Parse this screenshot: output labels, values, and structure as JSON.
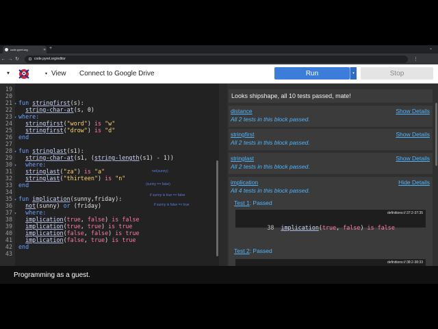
{
  "browser": {
    "tab_title": "code.pyret.org",
    "new_tab": "+",
    "url": "code.pyret.org/editor",
    "back": "←",
    "forward": "→",
    "reload": "↻",
    "menu": "⋮"
  },
  "toolbar": {
    "menu_icon": "▾",
    "view_caret": "▾",
    "view_label": "View",
    "drive_label": "Connect to Google Drive",
    "run_label": "Run",
    "run_dropdown": "▾",
    "stop_label": "Stop"
  },
  "editor": {
    "lines": [
      {
        "n": "19",
        "fold": "",
        "tokens": []
      },
      {
        "n": "20",
        "fold": "",
        "tokens": []
      },
      {
        "n": "21",
        "fold": "▾",
        "tokens": [
          [
            "kw",
            "fun "
          ],
          [
            "fn",
            "stringfirst"
          ],
          [
            "txt",
            "(s):"
          ]
        ]
      },
      {
        "n": "22",
        "fold": "",
        "tokens": [
          [
            "txt",
            "  "
          ],
          [
            "fn",
            "string-char-at"
          ],
          [
            "txt",
            "(s, "
          ],
          [
            "num",
            "0"
          ],
          [
            "txt",
            ")"
          ]
        ]
      },
      {
        "n": "23",
        "fold": "▾",
        "tokens": [
          [
            "kw",
            "where:"
          ]
        ]
      },
      {
        "n": "24",
        "fold": "",
        "tokens": [
          [
            "txt",
            "  "
          ],
          [
            "fn",
            "stringfirst"
          ],
          [
            "txt",
            "("
          ],
          [
            "str",
            "\"word\""
          ],
          [
            "txt",
            ") "
          ],
          [
            "is",
            "is"
          ],
          [
            "txt",
            " "
          ],
          [
            "str",
            "\"w\""
          ]
        ]
      },
      {
        "n": "25",
        "fold": "",
        "tokens": [
          [
            "txt",
            "  "
          ],
          [
            "fn",
            "stringfirst"
          ],
          [
            "txt",
            "("
          ],
          [
            "str",
            "\"drow\""
          ],
          [
            "txt",
            ") "
          ],
          [
            "is",
            "is"
          ],
          [
            "txt",
            " "
          ],
          [
            "str",
            "\"d\""
          ]
        ]
      },
      {
        "n": "26",
        "fold": "",
        "tokens": [
          [
            "kw",
            "end"
          ]
        ]
      },
      {
        "n": "27",
        "fold": "",
        "tokens": []
      },
      {
        "n": "28",
        "fold": "▾",
        "tokens": [
          [
            "kw",
            "fun "
          ],
          [
            "fn",
            "stringlast"
          ],
          [
            "txt",
            "(s1):"
          ]
        ]
      },
      {
        "n": "29",
        "fold": "",
        "tokens": [
          [
            "txt",
            "  "
          ],
          [
            "fn",
            "string-char-at"
          ],
          [
            "txt",
            "(s1, ("
          ],
          [
            "fn",
            "string-length"
          ],
          [
            "txt",
            "(s1) - "
          ],
          [
            "num",
            "1"
          ],
          [
            "txt",
            "))"
          ]
        ]
      },
      {
        "n": "30",
        "fold": "▾",
        "tokens": [
          [
            "txt",
            "  "
          ],
          [
            "kw",
            "where:"
          ]
        ]
      },
      {
        "n": "31",
        "fold": "",
        "tokens": [
          [
            "txt",
            "  "
          ],
          [
            "fn",
            "stringlast"
          ],
          [
            "txt",
            "("
          ],
          [
            "str",
            "\"za\""
          ],
          [
            "txt",
            ") "
          ],
          [
            "is",
            "is"
          ],
          [
            "txt",
            " "
          ],
          [
            "str",
            "\"a\""
          ]
        ]
      },
      {
        "n": "32",
        "fold": "",
        "tokens": [
          [
            "txt",
            "  "
          ],
          [
            "fn",
            "stringlast"
          ],
          [
            "txt",
            "("
          ],
          [
            "str",
            "\"thirteen\""
          ],
          [
            "txt",
            ") "
          ],
          [
            "is",
            "is"
          ],
          [
            "txt",
            " "
          ],
          [
            "str",
            "\"n\""
          ]
        ]
      },
      {
        "n": "33",
        "fold": "",
        "tokens": [
          [
            "kw",
            "end"
          ]
        ]
      },
      {
        "n": "34",
        "fold": "",
        "tokens": []
      },
      {
        "n": "35",
        "fold": "▾",
        "tokens": [
          [
            "kw",
            "fun "
          ],
          [
            "fn",
            "implication"
          ],
          [
            "txt",
            "(sunny,friday):"
          ]
        ]
      },
      {
        "n": "36",
        "fold": "",
        "tokens": [
          [
            "txt",
            "  "
          ],
          [
            "fn",
            "not"
          ],
          [
            "txt",
            "(sunny) "
          ],
          [
            "kw",
            "or"
          ],
          [
            "txt",
            " (friday)"
          ]
        ]
      },
      {
        "n": "37",
        "fold": "▾",
        "tokens": [
          [
            "txt",
            "  "
          ],
          [
            "kw",
            "where:"
          ]
        ]
      },
      {
        "n": "38",
        "fold": "",
        "tokens": [
          [
            "txt",
            "  "
          ],
          [
            "fn",
            "implication"
          ],
          [
            "txt",
            "("
          ],
          [
            "bool",
            "true"
          ],
          [
            "txt",
            ", "
          ],
          [
            "bool",
            "false"
          ],
          [
            "txt",
            ") "
          ],
          [
            "is",
            "is"
          ],
          [
            "txt",
            " "
          ],
          [
            "bool",
            "false"
          ]
        ]
      },
      {
        "n": "39",
        "fold": "",
        "tokens": [
          [
            "txt",
            "  "
          ],
          [
            "fn",
            "implication"
          ],
          [
            "txt",
            "("
          ],
          [
            "bool",
            "true"
          ],
          [
            "txt",
            ", "
          ],
          [
            "bool",
            "true"
          ],
          [
            "txt",
            ") "
          ],
          [
            "is",
            "is"
          ],
          [
            "txt",
            " "
          ],
          [
            "bool",
            "true"
          ]
        ]
      },
      {
        "n": "40",
        "fold": "",
        "tokens": [
          [
            "txt",
            "  "
          ],
          [
            "fn",
            "implication"
          ],
          [
            "txt",
            "("
          ],
          [
            "bool",
            "false"
          ],
          [
            "txt",
            ", "
          ],
          [
            "bool",
            "false"
          ],
          [
            "txt",
            ") "
          ],
          [
            "is",
            "is"
          ],
          [
            "txt",
            " "
          ],
          [
            "bool",
            "true"
          ]
        ]
      },
      {
        "n": "41",
        "fold": "",
        "tokens": [
          [
            "txt",
            "  "
          ],
          [
            "fn",
            "implication"
          ],
          [
            "txt",
            "("
          ],
          [
            "bool",
            "false"
          ],
          [
            "txt",
            ", "
          ],
          [
            "bool",
            "true"
          ],
          [
            "txt",
            ") "
          ],
          [
            "is",
            "is"
          ],
          [
            "txt",
            " "
          ],
          [
            "bool",
            "true"
          ]
        ]
      },
      {
        "n": "42",
        "fold": "",
        "tokens": [
          [
            "kw",
            "end"
          ]
        ]
      },
      {
        "n": "43",
        "fold": "",
        "tokens": []
      }
    ],
    "annotations": [
      "not(sunny)",
      "(sunny == false)",
      "if sunny is true => false",
      "if sunny is false => true"
    ]
  },
  "results": {
    "summary": "Looks shipshape, all 10 tests passed, mate!",
    "blocks": [
      {
        "name": "distance",
        "details": "Show Details",
        "status": "All 2 tests in this block passed."
      },
      {
        "name": "stringfirst",
        "details": "Show Details",
        "status": "All 2 tests in this block passed."
      },
      {
        "name": "stringlast",
        "details": "Show Details",
        "status": "All 2 tests in this block passed."
      },
      {
        "name": "implication",
        "details": "Hide Details",
        "status": "All 4 tests in this block passed."
      }
    ],
    "tests": [
      {
        "link": "Test 1",
        "result": ": Passed",
        "source": "definitions://:37:2-37:35",
        "line_no": "38",
        "code": "implication(true, false) is false"
      },
      {
        "link": "Test 2",
        "result": ": Passed",
        "source": "definitions://:38:2-38:33"
      }
    ]
  },
  "status": {
    "text": "Programming as a guest."
  }
}
